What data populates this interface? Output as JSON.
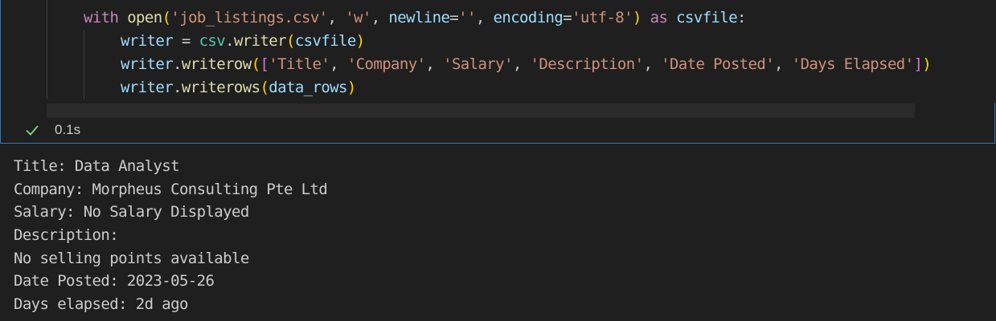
{
  "code_cell": {
    "lines": [
      [
        {
          "t": "with",
          "c": "kw"
        },
        {
          "t": " ",
          "c": "pl"
        },
        {
          "t": "open",
          "c": "fn"
        },
        {
          "t": "(",
          "c": "br1"
        },
        {
          "t": "'job_listings.csv'",
          "c": "str"
        },
        {
          "t": ", ",
          "c": "pl"
        },
        {
          "t": "'w'",
          "c": "str"
        },
        {
          "t": ", ",
          "c": "pl"
        },
        {
          "t": "newline",
          "c": "var"
        },
        {
          "t": "=",
          "c": "pl"
        },
        {
          "t": "''",
          "c": "str"
        },
        {
          "t": ", ",
          "c": "pl"
        },
        {
          "t": "encoding",
          "c": "var"
        },
        {
          "t": "=",
          "c": "pl"
        },
        {
          "t": "'utf-8'",
          "c": "str"
        },
        {
          "t": ")",
          "c": "br1"
        },
        {
          "t": " ",
          "c": "pl"
        },
        {
          "t": "as",
          "c": "kw"
        },
        {
          "t": " ",
          "c": "pl"
        },
        {
          "t": "csvfile",
          "c": "var"
        },
        {
          "t": ":",
          "c": "pl"
        }
      ],
      [
        {
          "t": "writer",
          "c": "var"
        },
        {
          "t": " = ",
          "c": "pl"
        },
        {
          "t": "csv",
          "c": "mod"
        },
        {
          "t": ".",
          "c": "pl"
        },
        {
          "t": "writer",
          "c": "fn"
        },
        {
          "t": "(",
          "c": "br1"
        },
        {
          "t": "csvfile",
          "c": "var"
        },
        {
          "t": ")",
          "c": "br1"
        }
      ],
      [
        {
          "t": "writer",
          "c": "var"
        },
        {
          "t": ".",
          "c": "pl"
        },
        {
          "t": "writerow",
          "c": "fn"
        },
        {
          "t": "(",
          "c": "br1"
        },
        {
          "t": "[",
          "c": "br2"
        },
        {
          "t": "'Title'",
          "c": "str"
        },
        {
          "t": ", ",
          "c": "pl"
        },
        {
          "t": "'Company'",
          "c": "str"
        },
        {
          "t": ", ",
          "c": "pl"
        },
        {
          "t": "'Salary'",
          "c": "str"
        },
        {
          "t": ", ",
          "c": "pl"
        },
        {
          "t": "'Description'",
          "c": "str"
        },
        {
          "t": ", ",
          "c": "pl"
        },
        {
          "t": "'Date Posted'",
          "c": "str"
        },
        {
          "t": ", ",
          "c": "pl"
        },
        {
          "t": "'Days Elapsed'",
          "c": "str"
        },
        {
          "t": "]",
          "c": "br2"
        },
        {
          "t": ")",
          "c": "br1"
        }
      ],
      [
        {
          "t": "writer",
          "c": "var"
        },
        {
          "t": ".",
          "c": "pl"
        },
        {
          "t": "writerows",
          "c": "fn"
        },
        {
          "t": "(",
          "c": "br1"
        },
        {
          "t": "data_rows",
          "c": "var"
        },
        {
          "t": ")",
          "c": "br1"
        }
      ]
    ]
  },
  "status": {
    "icon": "check-icon",
    "icon_color": "#89d185",
    "duration": "0.1s"
  },
  "output": {
    "lines": [
      "Title: Data Analyst",
      "Company: Morpheus Consulting Pte Ltd",
      "Salary: No Salary Displayed",
      "Description:",
      "No selling points available",
      "Date Posted: 2023-05-26",
      "Days elapsed: 2d ago"
    ]
  },
  "colors": {
    "background": "#1f1f1f",
    "cell_border": "#2b79c2",
    "keyword": "#c586c0",
    "function": "#dcdcaa",
    "string": "#ce9178",
    "variable": "#9cdcfe",
    "module": "#4ec9b0",
    "bracket_1": "#ffd700",
    "bracket_2": "#da70d6",
    "plain": "#cccccc"
  }
}
